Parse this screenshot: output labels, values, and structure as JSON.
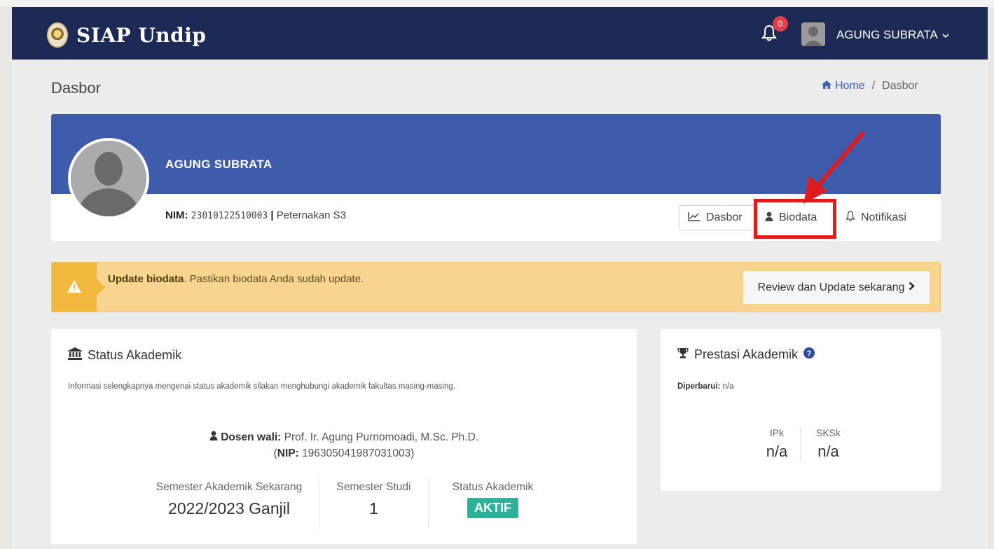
{
  "app": {
    "brand": "SIAP Undip",
    "notification_count": "0",
    "user_name": "AGUNG SUBRATA"
  },
  "header": {
    "page_title": "Dasbor",
    "breadcrumb": [
      "Home",
      "/",
      "Dasbor"
    ]
  },
  "profile": {
    "name": "AGUNG SUBRATA",
    "nim_label": "NIM:",
    "nim_value": "23010122510003",
    "separator": "|",
    "program": "Peternakan S3",
    "tabs": [
      {
        "label": "Dasbor",
        "icon": "line-chart-icon"
      },
      {
        "label": "Biodata",
        "icon": "user-icon"
      },
      {
        "label": "Notifikasi",
        "icon": "bell-icon"
      }
    ],
    "highlight_color": "#e01b1b"
  },
  "alert": {
    "title": "Update biodata",
    "message": ". Pastikan biodata Anda sudah update.",
    "button": "Review dan Update sekarang"
  },
  "status_akademik": {
    "title": "Status Akademik",
    "info": "Informasi selengkapnya mengenai status akademik silakan menghubungi akademik fakultas masing-masing.",
    "dosen_label": "Dosen wali:",
    "dosen_name": "Prof. Ir. Agung Purnomoadi, M.Sc. Ph.D.",
    "nip_label": "NIP:",
    "nip_value": "196305041987031003",
    "semester_label": "Semester Akademik Sekarang",
    "semester_value": "2022/2023 Ganjil",
    "studi_label": "Semester Studi",
    "studi_value": "1",
    "status_label": "Status Akademik",
    "status_value": "AKTIF"
  },
  "prestasi": {
    "title": "Prestasi Akademik",
    "updated_label": "Diperbarui:",
    "updated_value": "n/a",
    "ipk_label": "IPk",
    "ipk_value": "n/a",
    "sksk_label": "SKSk",
    "sksk_value": "n/a"
  },
  "colors": {
    "navbar": "#1c2a55",
    "cover": "#3f5bac",
    "alert_bg": "#f8d58e",
    "alert_icon_bg": "#f2b73d",
    "status_badge": "#2bb39a"
  }
}
